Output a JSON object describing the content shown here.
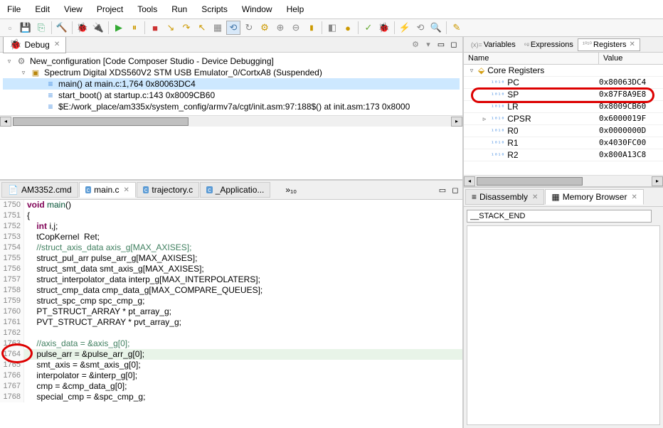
{
  "menu": [
    "File",
    "Edit",
    "View",
    "Project",
    "Tools",
    "Run",
    "Scripts",
    "Window",
    "Help"
  ],
  "debug": {
    "tab": "Debug",
    "tree": [
      {
        "indent": 0,
        "icon": "gear",
        "expand": "▿",
        "text": "New_configuration [Code Composer Studio - Device Debugging]"
      },
      {
        "indent": 1,
        "icon": "chip",
        "expand": "▿",
        "text": "Spectrum Digital XDS560V2 STM USB Emulator_0/CortxA8 (Suspended)"
      },
      {
        "indent": 2,
        "icon": "lines",
        "expand": "",
        "text": "main() at main.c:1,764 0x80063DC4",
        "sel": true
      },
      {
        "indent": 2,
        "icon": "lines",
        "expand": "",
        "text": "start_boot() at startup.c:143 0x8009CB60"
      },
      {
        "indent": 2,
        "icon": "lines",
        "expand": "",
        "text": "$E:/work_place/am335x/system_config/armv7a/cgt/init.asm:97:188$() at init.asm:173 0x8000"
      }
    ]
  },
  "editor": {
    "tabs": [
      {
        "label": "AM3352.cmd",
        "icon": "📄",
        "active": false
      },
      {
        "label": "main.c",
        "icon": "c",
        "active": true,
        "close": true
      },
      {
        "label": "trajectory.c",
        "icon": "c",
        "active": false
      },
      {
        "label": "_Applicatio...",
        "icon": "c",
        "active": false
      }
    ],
    "more": "»₁₀",
    "lines": [
      {
        "n": 1750,
        "html": "<span class='kw'>void</span> <span class='ty'>main</span>()"
      },
      {
        "n": 1751,
        "html": "{"
      },
      {
        "n": 1752,
        "html": "    <span class='kw'>int</span> i,j;"
      },
      {
        "n": 1753,
        "html": "    tCopKernel  Ret;"
      },
      {
        "n": 1754,
        "html": "    <span class='cm'>//struct_axis_data axis_g[MAX_AXISES];</span>"
      },
      {
        "n": 1755,
        "html": "    struct_pul_arr pulse_arr_g[MAX_AXISES];"
      },
      {
        "n": 1756,
        "html": "    struct_smt_data smt_axis_g[MAX_AXISES];"
      },
      {
        "n": 1757,
        "html": "    struct_interpolator_data interp_g[MAX_INTERPOLATERS];"
      },
      {
        "n": 1758,
        "html": "    struct_cmp_data cmp_data_g[MAX_COMPARE_QUEUES];"
      },
      {
        "n": 1759,
        "html": "    struct_spc_cmp spc_cmp_g;"
      },
      {
        "n": 1760,
        "html": "    PT_STRUCT_ARRAY * pt_array_g;"
      },
      {
        "n": 1761,
        "html": "    PVT_STRUCT_ARRAY * pvt_array_g;"
      },
      {
        "n": 1762,
        "html": ""
      },
      {
        "n": 1763,
        "html": "    <span class='cm'>//axis_data = &axis_g[0];</span>"
      },
      {
        "n": 1764,
        "html": "    pulse_arr = &pulse_arr_g[0];",
        "hl": true
      },
      {
        "n": 1765,
        "html": "    smt_axis = &smt_axis_g[0];"
      },
      {
        "n": 1766,
        "html": "    interpolator = &interp_g[0];"
      },
      {
        "n": 1767,
        "html": "    cmp = &cmp_data_g[0];"
      },
      {
        "n": 1768,
        "html": "    special_cmp = &spc_cmp_g;"
      }
    ]
  },
  "vars": {
    "tabs": [
      {
        "label": "Variables",
        "prefix": "(x)="
      },
      {
        "label": "Expressions",
        "prefix": "⁶ᵍ"
      },
      {
        "label": "Registers",
        "prefix": "¹⁰¹⁰",
        "active": true,
        "close": true
      }
    ],
    "cols": {
      "name": "Name",
      "value": "Value"
    },
    "group": "Core Registers",
    "regs": [
      {
        "name": "PC",
        "value": "0x80063DC4"
      },
      {
        "name": "SP",
        "value": "0x87F8A9E8",
        "circled": true
      },
      {
        "name": "LR",
        "value": "0x8009CB60"
      },
      {
        "name": "CPSR",
        "value": "0x6000019F",
        "expand": "▹"
      },
      {
        "name": "R0",
        "value": "0x0000000D"
      },
      {
        "name": "R1",
        "value": "0x4030FC00"
      },
      {
        "name": "R2",
        "value": "0x800A13C8"
      }
    ]
  },
  "br": {
    "tabs": [
      {
        "label": "Disassembly",
        "icon": "≡",
        "close": true
      },
      {
        "label": "Memory Browser",
        "icon": "▦",
        "close": true
      }
    ],
    "input": "__STACK_END"
  }
}
